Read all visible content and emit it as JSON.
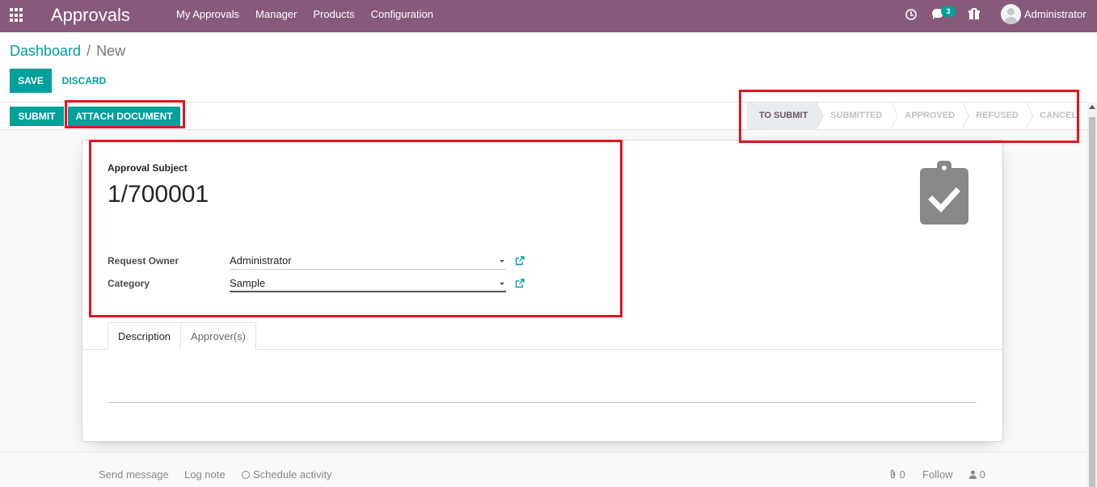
{
  "navbar": {
    "app_title": "Approvals",
    "menu": [
      "My Approvals",
      "Manager",
      "Products",
      "Configuration"
    ],
    "chat_badge": "3",
    "user": "Administrator",
    "color": "#875a7b"
  },
  "breadcrumb": {
    "root": "Dashboard",
    "separator": "/",
    "current": "New"
  },
  "actions": {
    "save": "SAVE",
    "discard": "DISCARD",
    "submit": "SUBMIT",
    "attach": "ATTACH DOCUMENT"
  },
  "stages": [
    "TO SUBMIT",
    "SUBMITTED",
    "APPROVED",
    "REFUSED",
    "CANCEL"
  ],
  "active_stage": "TO SUBMIT",
  "form": {
    "subject_label": "Approval Subject",
    "subject_value": "1/700001",
    "owner_label": "Request Owner",
    "owner_value": "Administrator",
    "category_label": "Category",
    "category_value": "Sample"
  },
  "tabs": [
    "Description",
    "Approver(s)"
  ],
  "chatter": {
    "send_message": "Send message",
    "log_note": "Log note",
    "schedule_activity": "Schedule activity",
    "attachments": "0",
    "follow": "Follow",
    "followers": "0"
  },
  "colors": {
    "primary": "#00a09d",
    "highlight": "#e3141f"
  }
}
